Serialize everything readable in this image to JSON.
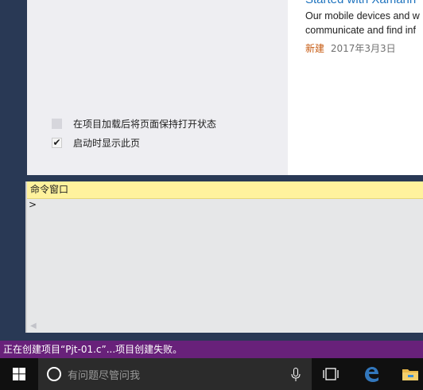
{
  "start_page": {
    "news": {
      "title": "Started with Xamarin",
      "description_line1": "Our mobile devices and w",
      "description_line2": "communicate and find inf",
      "badge": "新建",
      "date": "2017年3月3日"
    },
    "options": [
      {
        "label": "在项目加载后将页面保持打开状态",
        "checked": false
      },
      {
        "label": "启动时显示此页",
        "checked": true
      }
    ]
  },
  "command_window": {
    "title": "命令窗口",
    "prompt": ">"
  },
  "status_bar": {
    "text": "正在创建项目“Pjt-01.c”...项目创建失败。",
    "color": "#68217a"
  },
  "taskbar": {
    "search_placeholder": "有问题尽管问我",
    "icons": [
      "windows-start-icon",
      "cortana-icon",
      "microphone-icon",
      "task-view-icon",
      "edge-browser-icon",
      "file-explorer-icon"
    ]
  }
}
